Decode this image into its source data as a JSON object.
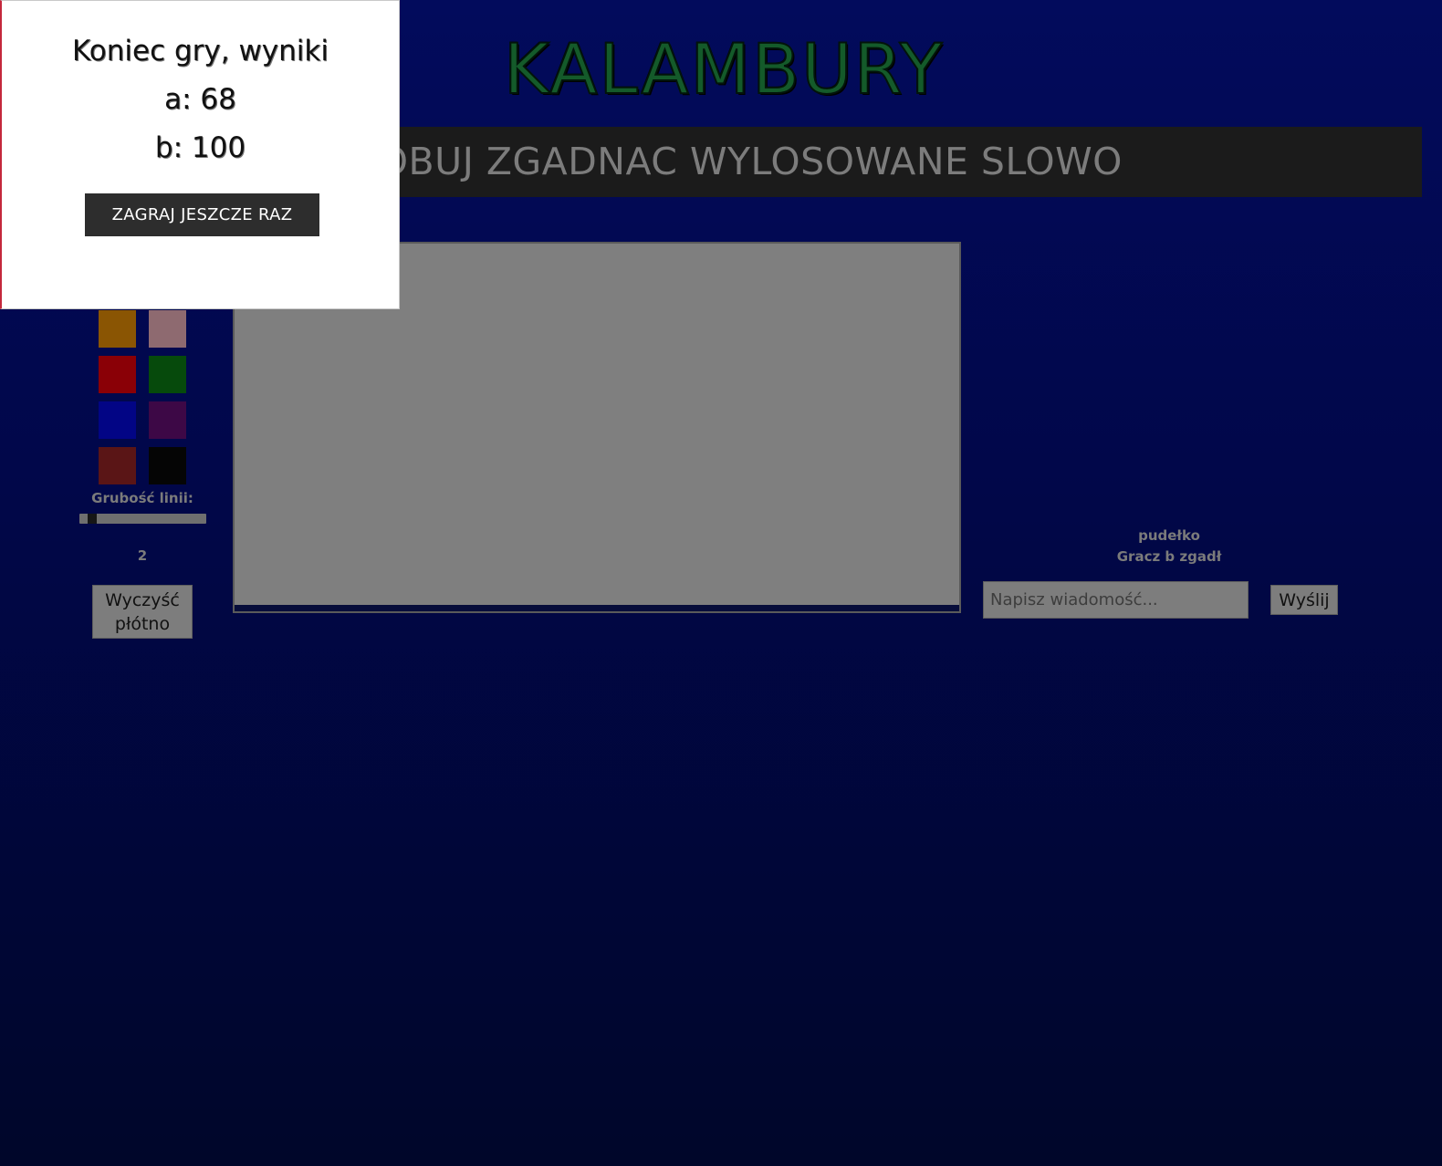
{
  "header": {
    "title": "KALAMBURY",
    "banner": "SPROBUJ ZGADNAC WYLOSOWANE SLOWO"
  },
  "toolbar": {
    "swatches": [
      {
        "name": "orange",
        "color": "#8a5503"
      },
      {
        "name": "pink",
        "color": "#8e6a70"
      },
      {
        "name": "red",
        "color": "#8a0006"
      },
      {
        "name": "green",
        "color": "#064a0c"
      },
      {
        "name": "blue",
        "color": "#020585"
      },
      {
        "name": "purple",
        "color": "#3d0846"
      },
      {
        "name": "maroon",
        "color": "#5a1516"
      },
      {
        "name": "black",
        "color": "#050505"
      }
    ],
    "line_width_label": "Grubość linii:",
    "line_width_value": "2",
    "line_width_fraction": 0.07,
    "clear_label": "Wyczyść płótno"
  },
  "canvas": {
    "background": "#7f7f7f"
  },
  "chat": {
    "messages": [
      "pudełko",
      "Gracz b zgadł"
    ],
    "input_placeholder": "Napisz wiadomość...",
    "input_value": "",
    "send_label": "Wyślij"
  },
  "modal": {
    "title": "Koniec gry, wyniki",
    "scores": [
      {
        "player": "a",
        "points": "68"
      },
      {
        "player": "b",
        "points": "100"
      }
    ],
    "replay_label": "ZAGRAJ JESZCZE RAZ"
  }
}
